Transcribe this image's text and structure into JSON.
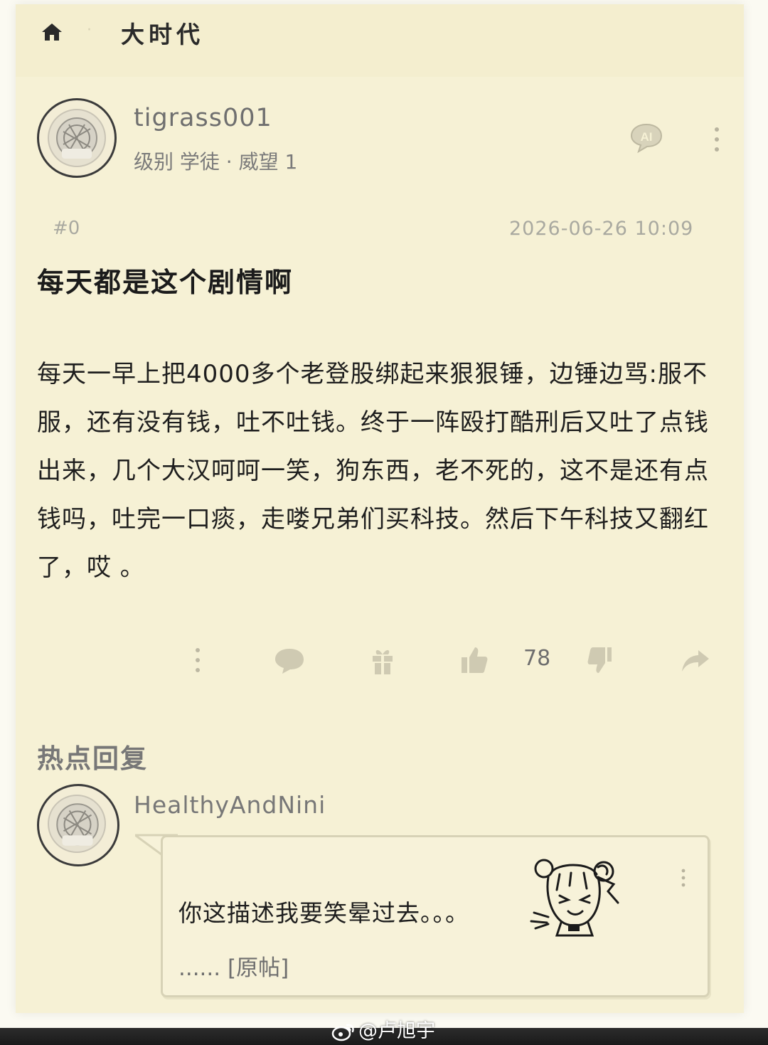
{
  "header": {
    "title": "大时代",
    "separator": "·"
  },
  "author": {
    "name": "tigrass001",
    "meta": "级别 学徒 · 威望 1"
  },
  "post": {
    "floor": "#0",
    "timestamp": "2026-06-26 10:09",
    "title": "每天都是这个剧情啊",
    "body": "每天一早上把4000多个老登股绑起来狠狠锤，边锤边骂:服不服，还有没有钱，吐不吐钱。终于一阵殴打酷刑后又吐了点钱出来，几个大汉呵呵一笑，狗东西，老不死的，这不是还有点钱吗，吐完一口痰，走喽兄弟们买科技。然后下午科技又翻红了，哎 。"
  },
  "actions": {
    "likes": "78",
    "icons": [
      "more-vertical-icon",
      "comment-icon",
      "gift-icon",
      "thumbs-up-icon",
      "thumbs-down-icon",
      "share-icon"
    ]
  },
  "hot_replies": {
    "heading": "热点回复",
    "items": [
      {
        "user": "HealthyAndNini",
        "text": "你这描述我要笑晕过去。。。",
        "link": "...... [原帖]"
      }
    ]
  },
  "watermark": "@卢旭宇"
}
